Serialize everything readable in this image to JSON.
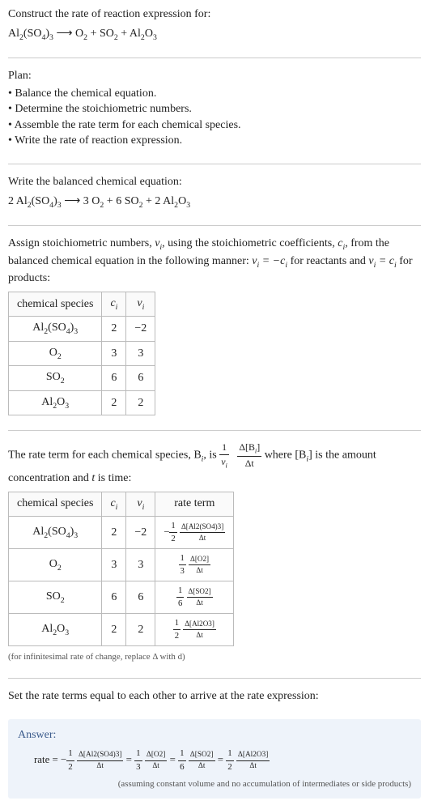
{
  "q": {
    "prompt": "Construct the rate of reaction expression for:",
    "eq_lhs": "Al",
    "eq_lhs_sub1": "2",
    "eq_lhs_mid": "(SO",
    "eq_lhs_sub2": "4",
    "eq_lhs_end": ")",
    "eq_lhs_sub3": "3",
    "arrow": " ⟶ ",
    "rhs1": "O",
    "rhs1s": "2",
    "plus": " + ",
    "rhs2": "SO",
    "rhs2s": "2",
    "rhs3": "Al",
    "rhs3s1": "2",
    "rhs3m": "O",
    "rhs3s2": "3"
  },
  "plan": {
    "heading": "Plan:",
    "items": [
      "Balance the chemical equation.",
      "Determine the stoichiometric numbers.",
      "Assemble the rate term for each chemical species.",
      "Write the rate of reaction expression."
    ]
  },
  "balanced": {
    "heading": "Write the balanced chemical equation:",
    "c1": "2 ",
    "sp1a": "Al",
    "sp1s1": "2",
    "sp1b": "(SO",
    "sp1s2": "4",
    "sp1c": ")",
    "sp1s3": "3",
    "arrow": " ⟶ ",
    "c2": "3 ",
    "sp2": "O",
    "sp2s": "2",
    "plus1": " + ",
    "c3": "6 ",
    "sp3": "SO",
    "sp3s": "2",
    "plus2": " + ",
    "c4": "2 ",
    "sp4a": "Al",
    "sp4s1": "2",
    "sp4b": "O",
    "sp4s2": "3"
  },
  "stoich": {
    "text_a": "Assign stoichiometric numbers, ",
    "nu": "ν",
    "sub_i": "i",
    "text_b": ", using the stoichiometric coefficients, ",
    "c": "c",
    "text_c": ", from the balanced chemical equation in the following manner: ",
    "eq1_l": "ν",
    "eq1_r": " = −c",
    "text_d": " for reactants and ",
    "eq2_l": "ν",
    "eq2_r": " = c",
    "text_e": " for products:",
    "headers": {
      "h1": "chemical species",
      "h2": "c",
      "h2sub": "i",
      "h3": "ν",
      "h3sub": "i"
    },
    "rows": [
      {
        "sp_html": "Al2(SO4)3",
        "c": "2",
        "nu": "−2"
      },
      {
        "sp_html": "O2",
        "c": "3",
        "nu": "3"
      },
      {
        "sp_html": "SO2",
        "c": "6",
        "nu": "6"
      },
      {
        "sp_html": "Al2O3",
        "c": "2",
        "nu": "2"
      }
    ]
  },
  "rate_intro": {
    "a": "The rate term for each chemical species, B",
    "b": ", is ",
    "frac1_num": "1",
    "frac1_den_a": "ν",
    "frac2_num_a": "Δ[B",
    "frac2_num_b": "]",
    "frac2_den": "Δt",
    "c": " where [B",
    "d": "] is the amount concentration and ",
    "t": "t",
    "e": " is time:"
  },
  "rate_table": {
    "headers": {
      "h1": "chemical species",
      "h2": "c",
      "h2s": "i",
      "h3": "ν",
      "h3s": "i",
      "h4": "rate term"
    },
    "rows": [
      {
        "c": "2",
        "nu": "−2",
        "sign": "−",
        "coef_num": "1",
        "coef_den": "2",
        "d_num": "Δ[Al2(SO4)3]",
        "d_den": "Δt"
      },
      {
        "c": "3",
        "nu": "3",
        "sign": "",
        "coef_num": "1",
        "coef_den": "3",
        "d_num": "Δ[O2]",
        "d_den": "Δt"
      },
      {
        "c": "6",
        "nu": "6",
        "sign": "",
        "coef_num": "1",
        "coef_den": "6",
        "d_num": "Δ[SO2]",
        "d_den": "Δt"
      },
      {
        "c": "2",
        "nu": "2",
        "sign": "",
        "coef_num": "1",
        "coef_den": "2",
        "d_num": "Δ[Al2O3]",
        "d_den": "Δt"
      }
    ],
    "note": "(for infinitesimal rate of change, replace Δ with d)"
  },
  "final": {
    "heading": "Set the rate terms equal to each other to arrive at the rate expression:"
  },
  "answer": {
    "label": "Answer:",
    "rate_word": "rate = ",
    "t1_sign": "−",
    "t1_n": "1",
    "t1_d": "2",
    "t1_dn": "Δ[Al2(SO4)3]",
    "t1_dd": "Δt",
    "eq": " = ",
    "t2_n": "1",
    "t2_d": "3",
    "t2_dn": "Δ[O2]",
    "t2_dd": "Δt",
    "t3_n": "1",
    "t3_d": "6",
    "t3_dn": "Δ[SO2]",
    "t3_dd": "Δt",
    "t4_n": "1",
    "t4_d": "2",
    "t4_dn": "Δ[Al2O3]",
    "t4_dd": "Δt",
    "note": "(assuming constant volume and no accumulation of intermediates or side products)"
  },
  "chart_data": {
    "type": "table",
    "title": "Stoichiometric numbers and rate terms for Al2(SO4)3 ⟶ O2 + SO2 + Al2O3 (balanced 2 Al2(SO4)3 ⟶ 3 O2 + 6 SO2 + 2 Al2O3)",
    "columns": [
      "chemical species",
      "c_i",
      "ν_i",
      "rate term"
    ],
    "rows": [
      [
        "Al2(SO4)3",
        2,
        -2,
        "-(1/2) Δ[Al2(SO4)3]/Δt"
      ],
      [
        "O2",
        3,
        3,
        "(1/3) Δ[O2]/Δt"
      ],
      [
        "SO2",
        6,
        6,
        "(1/6) Δ[SO2]/Δt"
      ],
      [
        "Al2O3",
        2,
        2,
        "(1/2) Δ[Al2O3]/Δt"
      ]
    ],
    "rate_expression": "rate = -(1/2) Δ[Al2(SO4)3]/Δt = (1/3) Δ[O2]/Δt = (1/6) Δ[SO2]/Δt = (1/2) Δ[Al2O3]/Δt"
  }
}
